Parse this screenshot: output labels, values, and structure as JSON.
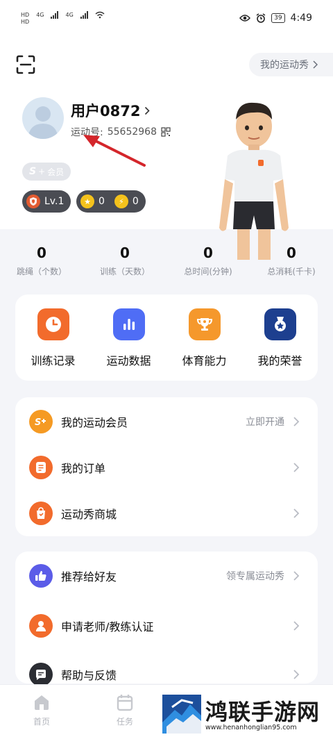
{
  "status_bar": {
    "net1": "HD",
    "net2": "HD",
    "sig1": "4G",
    "sig2": "4G",
    "battery": "39",
    "time": "4:49"
  },
  "header": {
    "show_button": "我的运动秀",
    "username": "用户0872",
    "sport_id_label": "运动号:",
    "sport_id": "55652968",
    "member_badge_s": "S",
    "member_badge_plus": "+",
    "member_badge_label": "会员",
    "level": "Lv.1",
    "coin_a": "0",
    "coin_b": "0"
  },
  "stats": [
    {
      "value": "0",
      "label": "跳绳（个数）"
    },
    {
      "value": "0",
      "label": "训练（天数）"
    },
    {
      "value": "0",
      "label": "总时间(分钟)"
    },
    {
      "value": "0",
      "label": "总消耗(千卡)"
    }
  ],
  "functions": [
    {
      "label": "训练记录",
      "icon": "clock-icon",
      "color": "#f26b2c"
    },
    {
      "label": "运动数据",
      "icon": "bar-chart-icon",
      "color": "#4f6df5"
    },
    {
      "label": "体育能力",
      "icon": "trophy-icon",
      "color": "#f5982c"
    },
    {
      "label": "我的荣誉",
      "icon": "medal-icon",
      "color": "#1d3f8f"
    }
  ],
  "list_a": [
    {
      "label": "我的运动会员",
      "extra": "立即开通",
      "icon": "membership-icon",
      "color": "#f59a23"
    },
    {
      "label": "我的订单",
      "extra": "",
      "icon": "order-icon",
      "color": "#f26b2c"
    },
    {
      "label": "运动秀商城",
      "extra": "",
      "icon": "shop-bag-icon",
      "color": "#f26b2c"
    }
  ],
  "list_b": [
    {
      "label": "推荐给好友",
      "extra": "领专属运动秀",
      "icon": "thumbs-up-icon",
      "color": "#5b5ce8"
    },
    {
      "label": "申请老师/教练认证",
      "extra": "",
      "icon": "teacher-icon",
      "color": "#f26b2c"
    },
    {
      "label": "帮助与反馈",
      "extra": "",
      "icon": "feedback-icon",
      "color": "#2b2d33"
    }
  ],
  "tabbar": [
    {
      "label": "首页",
      "icon": "home-icon"
    },
    {
      "label": "任务",
      "icon": "calendar-icon"
    }
  ],
  "watermark": {
    "title": "鸿联手游网",
    "url": "www.henanhonglian95.com"
  }
}
